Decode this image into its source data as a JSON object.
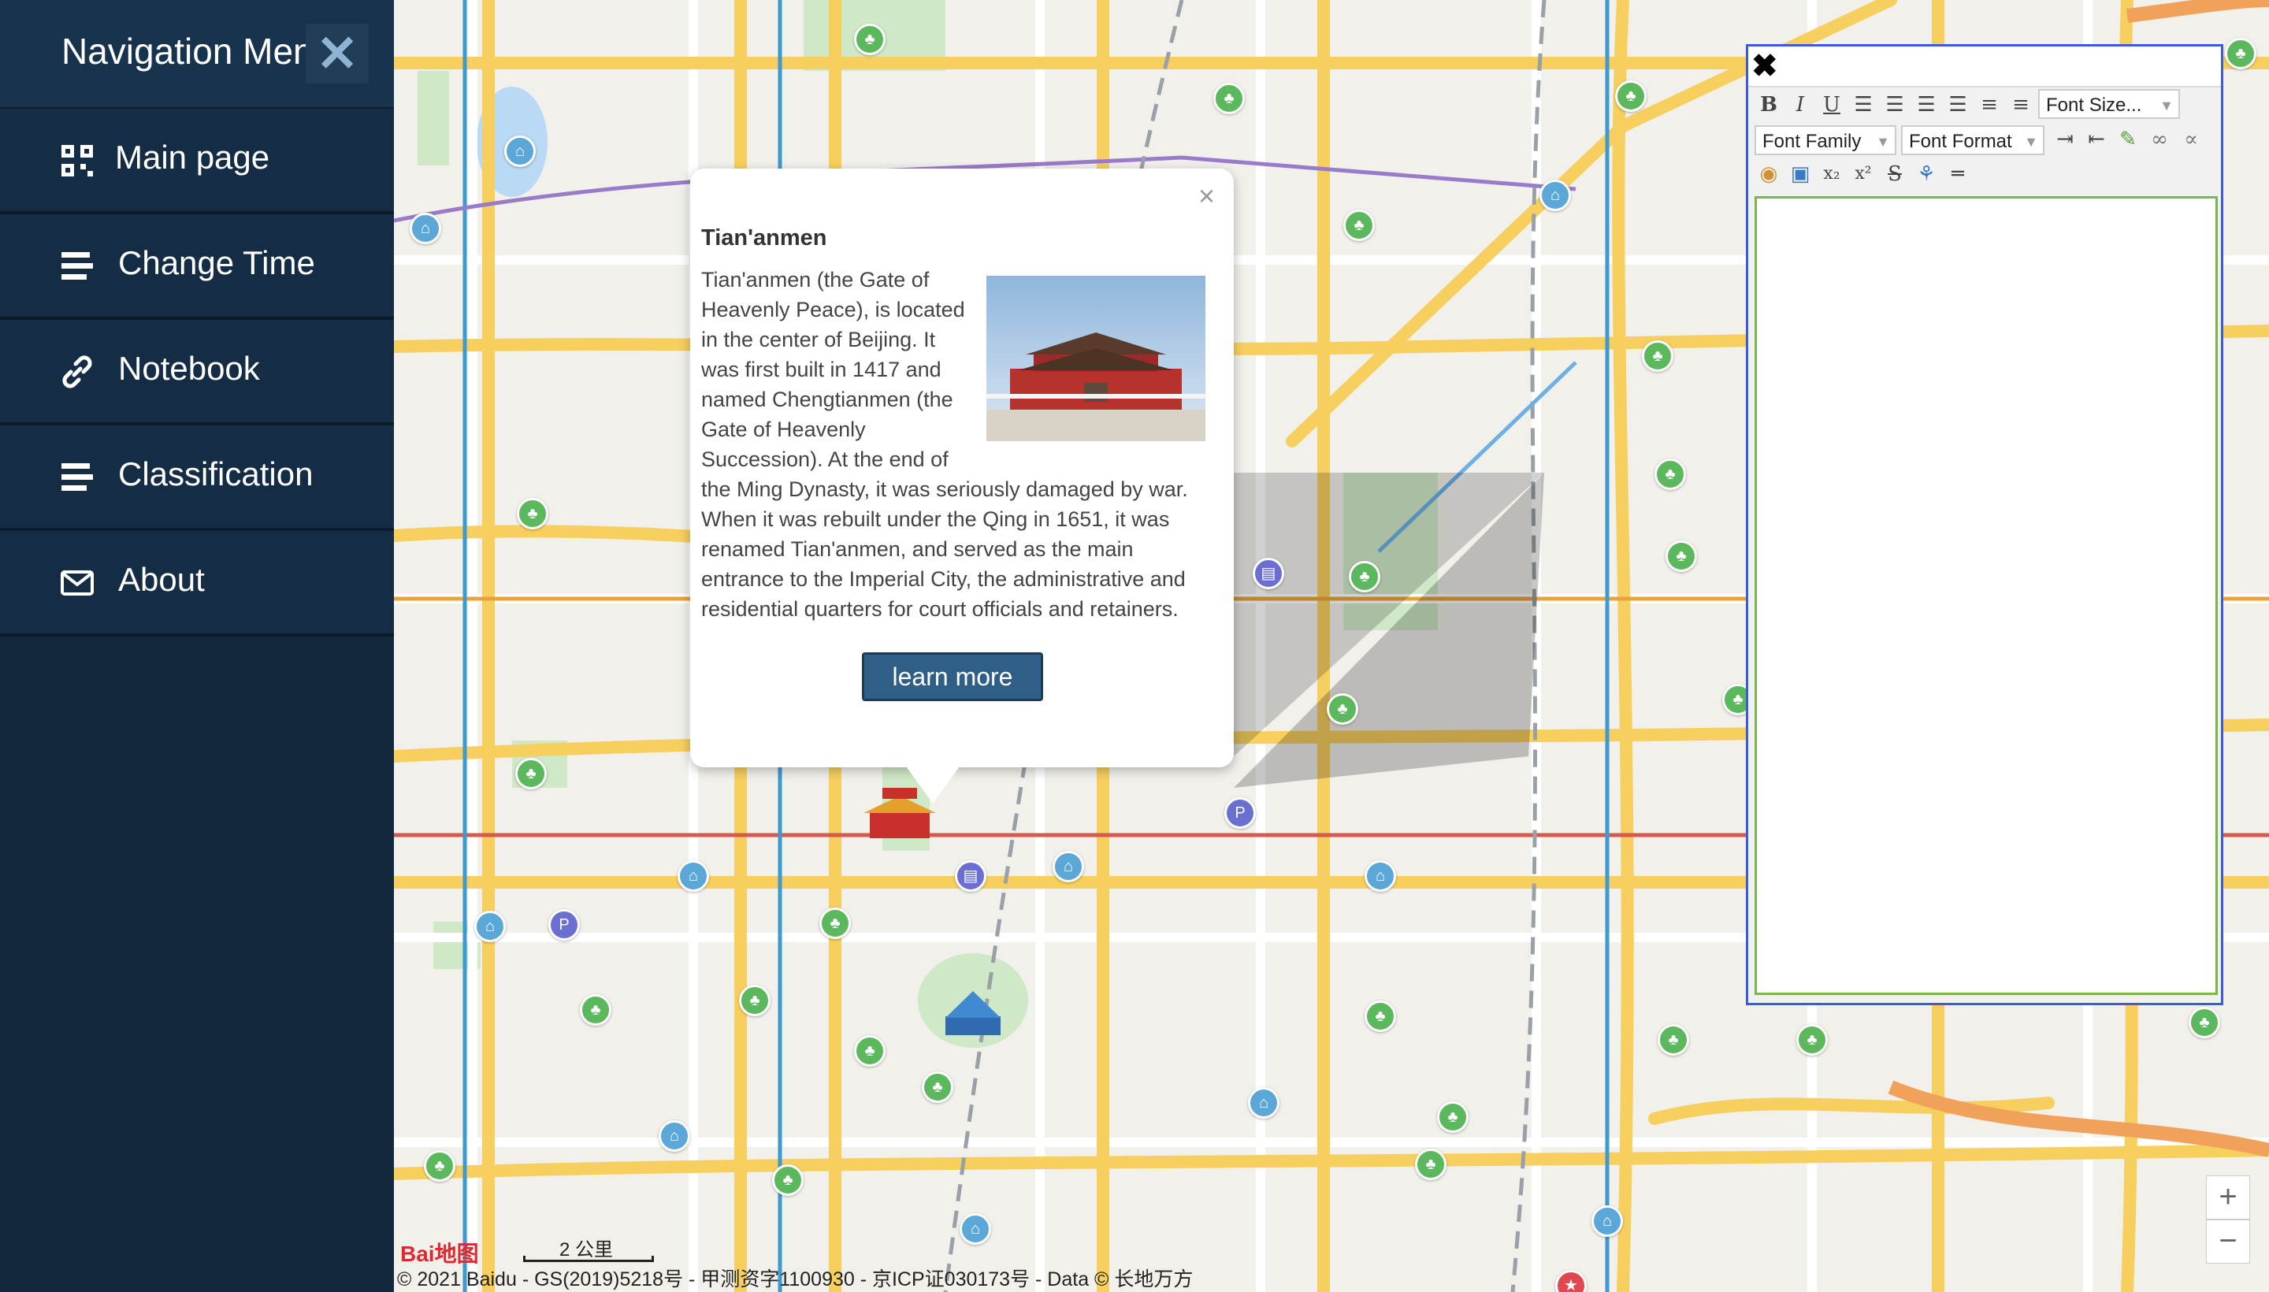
{
  "sidebar": {
    "title": "Navigation Menu",
    "items": [
      {
        "label": "Main page",
        "icon": "qr-grid-icon"
      },
      {
        "label": "Change Time",
        "icon": "lines-icon"
      },
      {
        "label": "Notebook",
        "icon": "link-icon"
      },
      {
        "label": "Classification",
        "icon": "lines-icon"
      },
      {
        "label": "About",
        "icon": "envelope-icon"
      }
    ]
  },
  "info_window": {
    "title": "Tian'anmen",
    "body": "Tian'anmen (the Gate of Heavenly Peace), is located in the center of Beijing. It was first built in 1417 and named Chengtianmen (the Gate of Heavenly Succession). At the end of the Ming Dynasty, it was seriously damaged by war. When it was rebuilt under the Qing in 1651, it was renamed Tian'anmen, and served as the main entrance to the Imperial City, the administrative and residential quarters for court officials and retainers.",
    "button": "learn more",
    "close": "×"
  },
  "editor": {
    "close": "✖",
    "font_size": "Font Size...",
    "font_family": "Font Family",
    "font_format": "Font Format",
    "toolbar_row1": [
      "B",
      "I",
      "U"
    ]
  },
  "map": {
    "logo": "Bai地图",
    "scale": "2 公里",
    "attribution": "© 2021 Baidu - GS(2019)5218号 - 甲测资字1100930 - 京ICP证030173号 - Data © 长地万方",
    "zoom_in": "+",
    "zoom_out": "−"
  },
  "colors": {
    "sidebar_bg": "#12283d",
    "button_bg": "#2f5f86",
    "editor_border": "#3c5bd6",
    "road_yellow": "#f6cf5e"
  }
}
